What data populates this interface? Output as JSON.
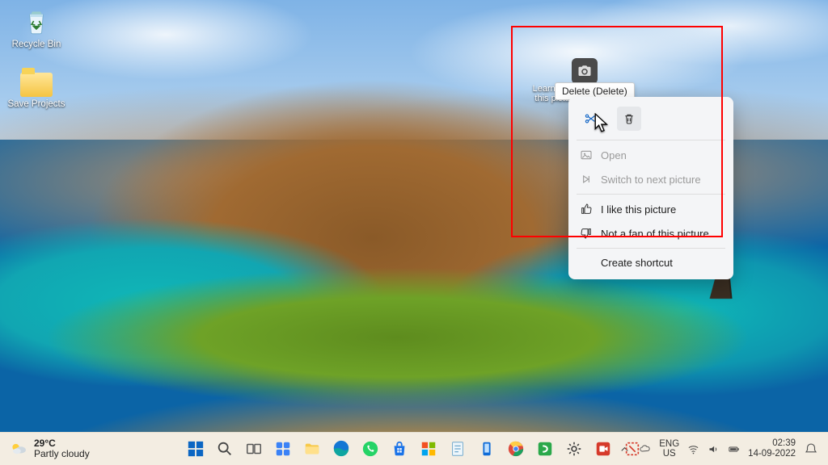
{
  "desktop_icons": [
    {
      "name": "recycle-bin",
      "label": "Recycle Bin"
    },
    {
      "name": "save-projects",
      "label": "Save Projects"
    }
  ],
  "spotlight": {
    "caption": "Learn about this picture"
  },
  "tooltip": "Delete (Delete)",
  "context_menu": {
    "quick_actions": [
      {
        "name": "cut",
        "icon": "scissors"
      },
      {
        "name": "delete",
        "icon": "trash"
      }
    ],
    "items": [
      {
        "name": "open",
        "label": "Open",
        "icon": "image",
        "disabled": true
      },
      {
        "name": "switch",
        "label": "Switch to next picture",
        "icon": "next",
        "disabled": true
      },
      {
        "sep": true
      },
      {
        "name": "like",
        "label": "I like this picture",
        "icon": "thumb-up"
      },
      {
        "name": "dislike",
        "label": "Not a fan of this picture",
        "icon": "thumb-down"
      },
      {
        "sep": true
      },
      {
        "name": "shortcut",
        "label": "Create shortcut",
        "icon": "none"
      }
    ]
  },
  "taskbar": {
    "weather": {
      "temp": "29°C",
      "desc": "Partly cloudy"
    },
    "pinned": [
      "start",
      "search",
      "task-view",
      "widgets",
      "explorer",
      "edge",
      "whatsapp",
      "store",
      "ms365",
      "calendar",
      "phone-link",
      "chrome",
      "camtasia",
      "settings",
      "camtasia-rec",
      "snip"
    ],
    "tray": {
      "lang_top": "ENG",
      "lang_bottom": "US",
      "time": "02:39",
      "date": "14-09-2022"
    }
  }
}
